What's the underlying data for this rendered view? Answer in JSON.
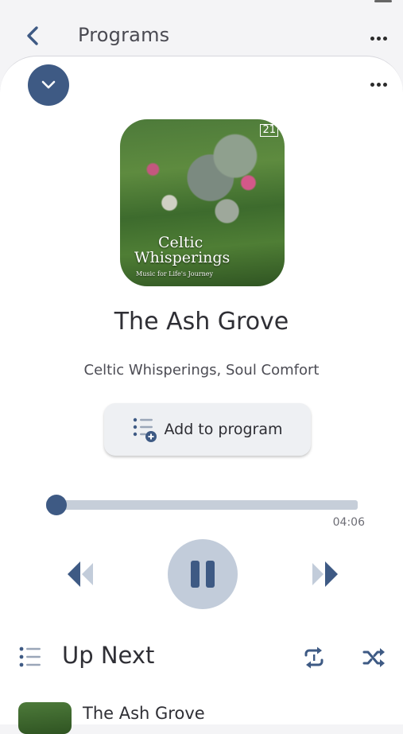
{
  "header": {
    "title": "Programs",
    "back_icon": "chevron-left-icon",
    "menu_icon": "more-horizontal-icon"
  },
  "player": {
    "collapse_icon": "chevron-down-icon",
    "menu_icon": "more-horizontal-icon",
    "artwork": {
      "album_title_line1": "Celtic",
      "album_title_line2": "Whisperings",
      "album_subtitle": "Music for Life's Journey",
      "logo": "21"
    },
    "track_title": "The Ash Grove",
    "track_artist": "Celtic Whisperings, Soul Comfort",
    "add_to_program_label": "Add to program",
    "progress_fraction": 0.0,
    "duration": "04:06",
    "controls": {
      "prev_icon": "skip-back-icon",
      "play_pause_icon": "pause-icon",
      "next_icon": "skip-forward-icon"
    }
  },
  "up_next": {
    "title": "Up Next",
    "list_icon": "list-icon",
    "repeat_icon": "repeat-one-icon",
    "shuffle_icon": "shuffle-icon",
    "items": [
      {
        "title": "The Ash Grove"
      }
    ]
  },
  "colors": {
    "accent": "#3e5a84",
    "accent_light": "#c2ccda",
    "background": "#f4f4f6",
    "sheet": "#ffffff"
  }
}
